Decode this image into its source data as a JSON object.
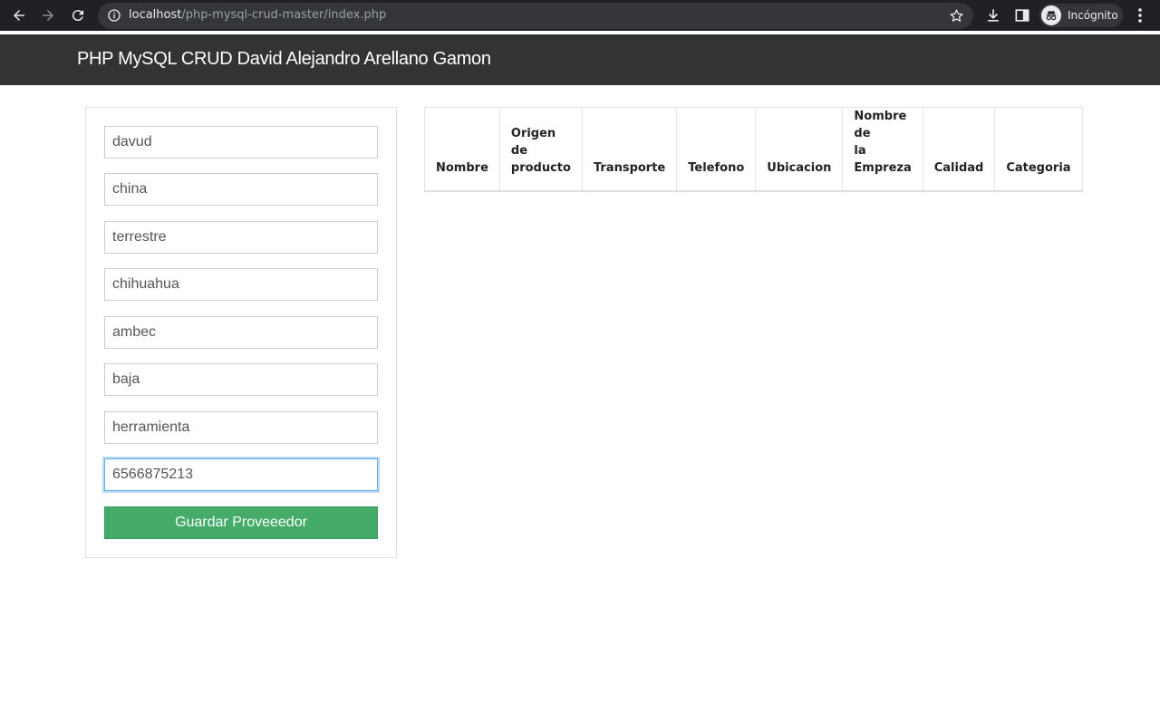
{
  "browser": {
    "url_host": "localhost",
    "url_path": "/php-mysql-crud-master/index.php",
    "profile_label": "Incógnito"
  },
  "header": {
    "title": "PHP MySQL CRUD David Alejandro Arellano Gamon"
  },
  "form": {
    "fields": [
      {
        "value": "davud"
      },
      {
        "value": "china"
      },
      {
        "value": "terrestre"
      },
      {
        "value": "chihuahua"
      },
      {
        "value": "ambec"
      },
      {
        "value": "baja"
      },
      {
        "value": "herramienta"
      },
      {
        "value": "6566875213"
      }
    ],
    "submit_label": "Guardar Proveeedor"
  },
  "table": {
    "headers": [
      {
        "line1": "Nombre",
        "line2": ""
      },
      {
        "line1": "Origen de",
        "line2": "producto"
      },
      {
        "line1": "Transporte",
        "line2": ""
      },
      {
        "line1": "Telefono",
        "line2": ""
      },
      {
        "line1": "Ubicacion",
        "line2": ""
      },
      {
        "line1": "Nombre de",
        "line2": "la Empreza"
      },
      {
        "line1": "Calidad",
        "line2": ""
      },
      {
        "line1": "Categoria",
        "line2": ""
      }
    ],
    "rows": []
  },
  "colors": {
    "header_bg": "#333333",
    "button_bg": "#45ab69",
    "focus_ring": "#66afe9"
  }
}
